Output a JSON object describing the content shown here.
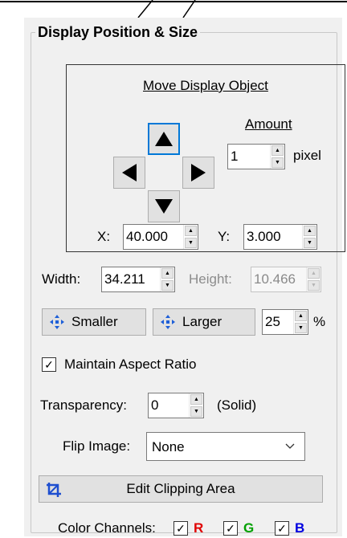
{
  "group": {
    "title": "Display Position & Size"
  },
  "move": {
    "title": "Move Display Object",
    "amount_label": "Amount",
    "amount_value": "1",
    "unit": "pixel",
    "x_label": "X:",
    "x_value": "40.000",
    "y_label": "Y:",
    "y_value": "3.000"
  },
  "size": {
    "width_label": "Width:",
    "width_value": "34.211",
    "height_label": "Height:",
    "height_value": "10.466"
  },
  "scale": {
    "smaller_label": "Smaller",
    "larger_label": "Larger",
    "percent_value": "25",
    "percent_sign": "%"
  },
  "aspect": {
    "label": "Maintain Aspect Ratio",
    "checked": true
  },
  "transparency": {
    "label": "Transparency:",
    "value": "0",
    "note": "(Solid)"
  },
  "flip": {
    "label": "Flip Image:",
    "selected": "None"
  },
  "clipping": {
    "label": "Edit Clipping Area"
  },
  "channels": {
    "label": "Color Channels:",
    "r": "R",
    "g": "G",
    "b": "B",
    "colors": {
      "r": "#e00000",
      "g": "#00a000",
      "b": "#0000e0"
    }
  },
  "colors": {
    "focus": "#0078d7",
    "panel": "#f0f0f0",
    "crop_icon": "#1e4fd0",
    "scale_icon": "#1e5fd8"
  }
}
